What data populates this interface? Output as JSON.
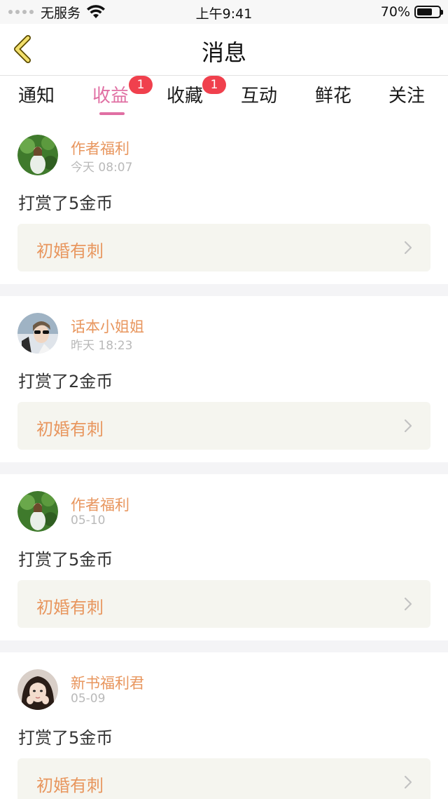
{
  "status_bar": {
    "carrier": "无服务",
    "time": "上午9:41",
    "battery_percent": "70%",
    "battery_level": 0.7
  },
  "nav": {
    "title": "消息"
  },
  "tabs": [
    {
      "label": "通知",
      "badge": ""
    },
    {
      "label": "收益",
      "badge": "1",
      "active": true
    },
    {
      "label": "收藏",
      "badge": "1"
    },
    {
      "label": "互动",
      "badge": ""
    },
    {
      "label": "鲜花",
      "badge": ""
    },
    {
      "label": "关注",
      "badge": ""
    }
  ],
  "messages": [
    {
      "sender": "作者福利",
      "time": "今天 08:07",
      "text": "打赏了5金币",
      "book": "初婚有刺",
      "avatar": "forest-girl-avatar"
    },
    {
      "sender": "话本小姐姐",
      "time": "昨天 18:23",
      "text": "打赏了2金币",
      "book": "初婚有刺",
      "avatar": "sunglasses-girl-avatar"
    },
    {
      "sender": "作者福利",
      "time": "05-10",
      "text": "打赏了5金币",
      "book": "初婚有刺",
      "avatar": "forest-girl-avatar"
    },
    {
      "sender": "新书福利君",
      "time": "05-09",
      "text": "打赏了5金币",
      "book": "初婚有刺",
      "avatar": "dark-hair-girl-avatar"
    }
  ],
  "colors": {
    "accent_pink": "#e06fa3",
    "accent_orange": "#e8965e",
    "badge_red": "#f0404d"
  }
}
